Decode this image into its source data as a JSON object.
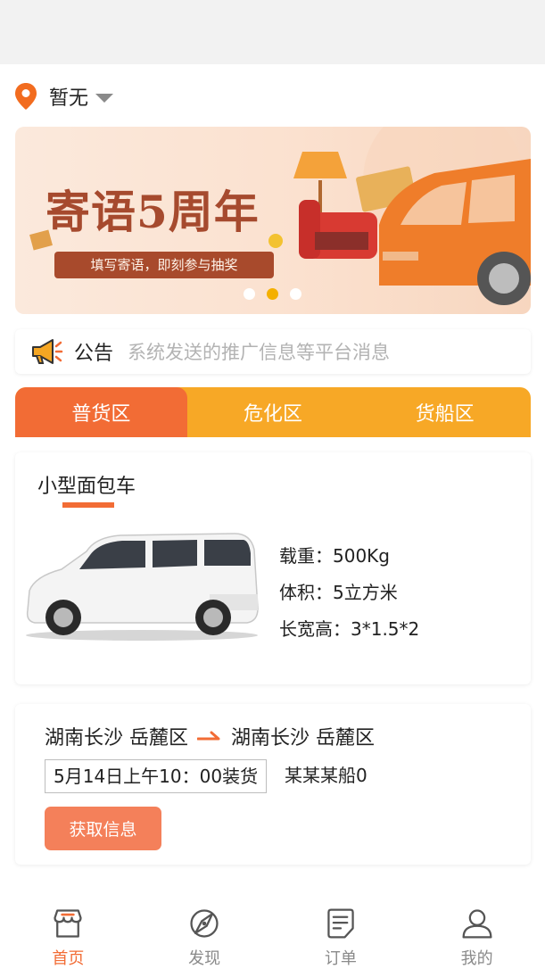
{
  "location": {
    "name": "暂无",
    "pin_icon": "location-pin-icon",
    "caret_icon": "caret-down-icon"
  },
  "banner": {
    "title": "寄语5周年",
    "subtitle": "填写寄语，即刻参与抽奖",
    "slide_count": 3,
    "active_slide": 2,
    "accent": "#a64a2e"
  },
  "notice": {
    "icon": "megaphone-icon",
    "label": "公告",
    "text": "系统发送的推广信息等平台消息"
  },
  "tabs": [
    {
      "label": "普货区",
      "active": true
    },
    {
      "label": "危化区",
      "active": false
    },
    {
      "label": "货船区",
      "active": false
    }
  ],
  "vehicle": {
    "name": "小型面包车",
    "specs": [
      "载重：500Kg",
      "体积：5立方米",
      "长宽高：3*1.5*2"
    ]
  },
  "order": {
    "origin": "湖南长沙 岳麓区",
    "destination": "湖南长沙 岳麓区",
    "load_time": "5月14日上午10：00装货",
    "ship_name": "某某某船0",
    "action_label": "获取信息"
  },
  "tabbar": [
    {
      "label": "首页",
      "icon": "home-store-icon",
      "active": true
    },
    {
      "label": "发现",
      "icon": "discover-compass-icon",
      "active": false
    },
    {
      "label": "订单",
      "icon": "order-document-icon",
      "active": false
    },
    {
      "label": "我的",
      "icon": "user-profile-icon",
      "active": false
    }
  ],
  "colors": {
    "primary": "#f26c35",
    "tab_bar": "#f7a826",
    "button": "#f4805a",
    "dot_active": "#f4b000"
  }
}
